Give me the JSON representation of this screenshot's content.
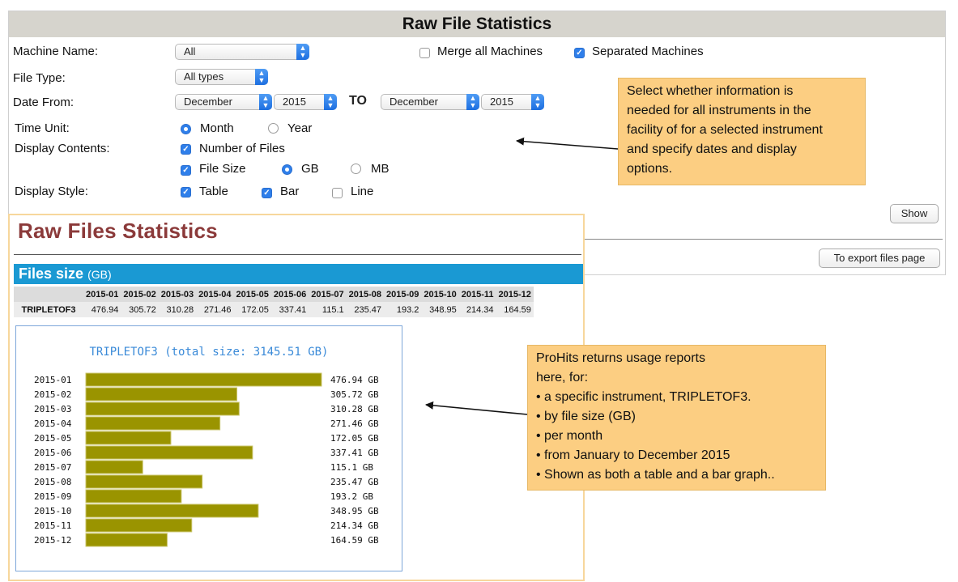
{
  "form": {
    "title": "Raw File Statistics",
    "machine_name": {
      "label": "Machine Name:",
      "value": "All"
    },
    "merge_all": {
      "label": "Merge all Machines",
      "checked": false
    },
    "separated": {
      "label": "Separated Machines",
      "checked": true
    },
    "file_type": {
      "label": "File Type:",
      "value": "All types"
    },
    "date_from": {
      "label": "Date From:",
      "from_month": "December",
      "from_year": "2015",
      "to_label": "TO",
      "to_month": "December",
      "to_year": "2015"
    },
    "time_unit": {
      "label": "Time Unit:",
      "month": "Month",
      "year": "Year",
      "selected": "Month"
    },
    "display_contents": {
      "label": "Display Contents:",
      "number_of_files": "Number of Files",
      "file_size": "File Size",
      "gb": "GB",
      "mb": "MB",
      "unit_selected": "GB"
    },
    "display_style": {
      "label": "Display Style:",
      "table": "Table",
      "bar": "Bar",
      "line": "Line"
    },
    "show_button": "Show",
    "export_button": "To export files page"
  },
  "report": {
    "title": "Raw Files Statistics",
    "section_title": "Files size",
    "section_unit": "(GB)",
    "table": {
      "headers": [
        "2015-01",
        "2015-02",
        "2015-03",
        "2015-04",
        "2015-05",
        "2015-06",
        "2015-07",
        "2015-08",
        "2015-09",
        "2015-10",
        "2015-11",
        "2015-12"
      ],
      "rows": [
        {
          "name": "TRIPLETOF3",
          "values": [
            "476.94",
            "305.72",
            "310.28",
            "271.46",
            "172.05",
            "337.41",
            "115.1",
            "235.47",
            "193.2",
            "348.95",
            "214.34",
            "164.59"
          ]
        }
      ]
    }
  },
  "chart_data": {
    "type": "bar",
    "orientation": "horizontal",
    "title": "TRIPLETOF3 (total size: 3145.51 GB)",
    "categories": [
      "2015-01",
      "2015-02",
      "2015-03",
      "2015-04",
      "2015-05",
      "2015-06",
      "2015-07",
      "2015-08",
      "2015-09",
      "2015-10",
      "2015-11",
      "2015-12"
    ],
    "values": [
      476.94,
      305.72,
      310.28,
      271.46,
      172.05,
      337.41,
      115.1,
      235.47,
      193.2,
      348.95,
      214.34,
      164.59
    ],
    "value_labels": [
      "476.94 GB",
      "305.72 GB",
      "310.28 GB",
      "271.46 GB",
      "172.05 GB",
      "337.41 GB",
      "115.1 GB",
      "235.47 GB",
      "193.2 GB",
      "348.95 GB",
      "214.34 GB",
      "164.59 GB"
    ],
    "bar_color": "#9a9400",
    "xlim": [
      0,
      476.94
    ],
    "grid": false
  },
  "callouts": {
    "top": [
      "Select whether information is",
      "needed for all instruments in the",
      "facility of for a selected instrument",
      "and specify dates and display",
      "options."
    ],
    "bottom": [
      "ProHits returns usage reports",
      "here, for:",
      "• a specific instrument, TRIPLETOF3.",
      "• by file size (GB)",
      "• per month",
      "• from January to December 2015",
      "• Shown as both a table and a bar graph.."
    ]
  },
  "colors": {
    "accent": "#1a99d3",
    "report_title": "#8b3a3a",
    "callout": "#fcce82",
    "checkbox": "#2f7fea"
  }
}
